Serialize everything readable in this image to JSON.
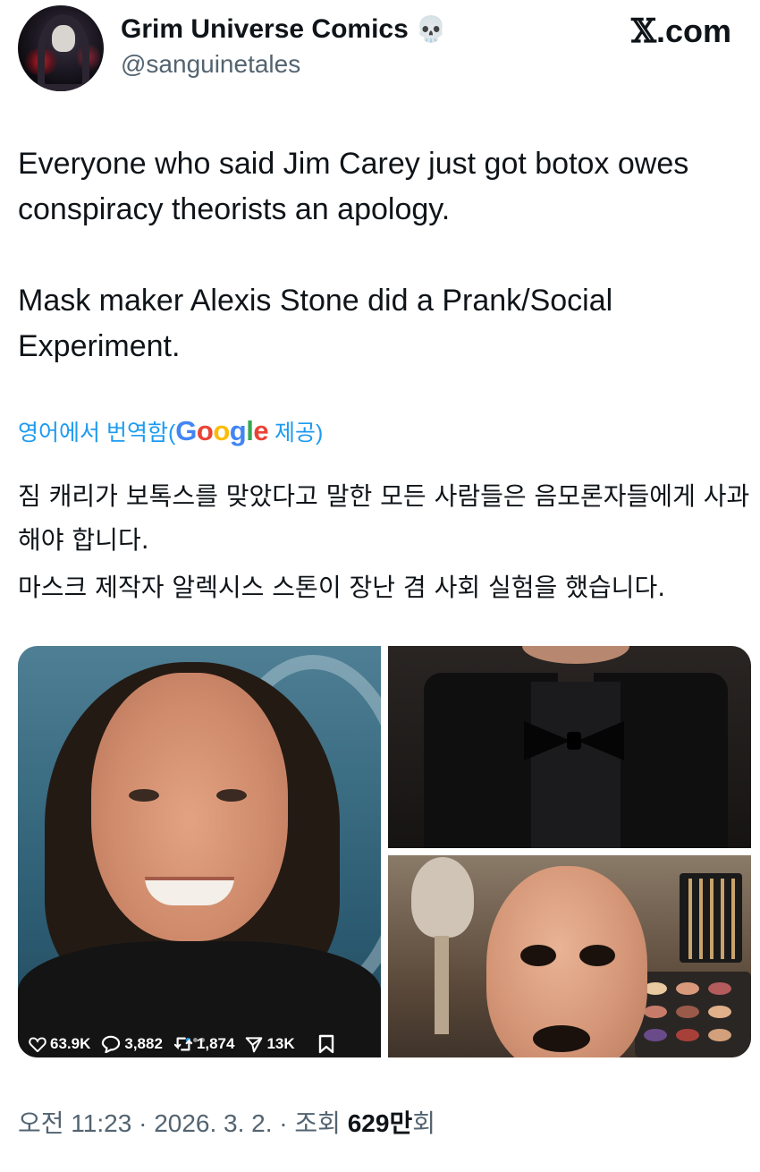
{
  "header": {
    "display_name": "Grim Universe Comics",
    "name_emoji": "💀",
    "handle": "@sanguinetales",
    "site": ".com",
    "site_x": "𝕏"
  },
  "tweet": {
    "paragraph1": "Everyone who said Jim Carey just got botox owes conspiracy theorists an apology.",
    "paragraph2": "Mask maker Alexis Stone did a Prank/Social Experiment."
  },
  "translation": {
    "link_prefix": "영어에서 번역함(",
    "google_letters": [
      "G",
      "o",
      "o",
      "g",
      "l",
      "e"
    ],
    "link_suffix": " 제공)",
    "line1": "짐 캐리가 보톡스를 맞았다고 말한 모든 사람들은 음모론자들에게 사과해야 합니다.",
    "line2": "마스크 제작자 알렉시스 스톤이 장난 겸 사회 실험을 했습니다."
  },
  "stats": {
    "likes": "63.9K",
    "replies": "3,882",
    "reposts": "1,874",
    "shares": "13K"
  },
  "footer": {
    "time": "오전 11:23",
    "sep": " · ",
    "date": "2026. 3. 2.",
    "views_label": "조회 ",
    "views_value": "629만",
    "views_suffix": "회"
  },
  "colors": {
    "link_blue": "#1d9bf0",
    "text": "#0f1419",
    "secondary": "#536471"
  }
}
